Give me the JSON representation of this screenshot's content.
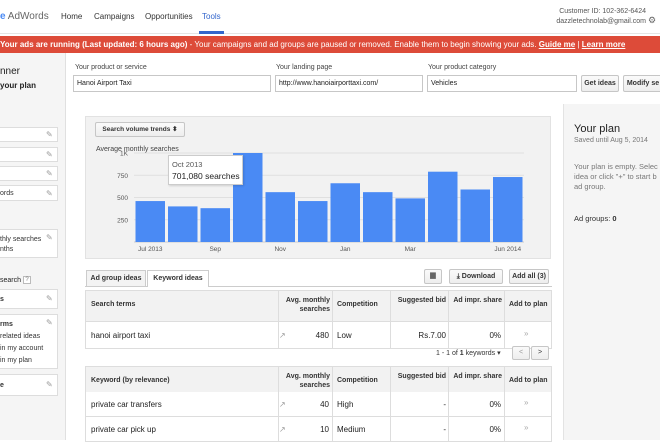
{
  "header": {
    "logo_google": "e",
    "logo_text": "AdWords",
    "nav": [
      "Home",
      "Campaigns",
      "Opportunities",
      "Tools"
    ],
    "customer_id": "Customer ID: 102-362-6424",
    "email": "dazzletechnolab@gmail.com"
  },
  "alert": {
    "bold_text": "Your ads are running (Last updated: 6 hours ago)",
    "text": " - Your campaigns and ad groups are paused or removed. Enable them to begin showing your ads.",
    "link1": "Guide me",
    "sep": " | ",
    "link2": "Learn more"
  },
  "left": {
    "title1": "nner",
    "title2": "your plan",
    "item_words": "ords",
    "monthly1": "thly searches",
    "monthly2": "nths",
    "search": "search",
    "s_label": "s",
    "terms": "rms",
    "related": "related ideas",
    "account": "in my account",
    "plan": "in my plan",
    "e_label": "e"
  },
  "form": {
    "product_label": "Your product or service",
    "product_value": "Hanoi Airport Taxi",
    "landing_label": "Your landing page",
    "landing_value": "http://www.hanoiairporttaxi.com/",
    "category_label": "Your product category",
    "category_value": "Vehicles",
    "get_ideas": "Get ideas",
    "modify": "Modify se"
  },
  "chart_panel": {
    "dropdown": "Search volume trends",
    "dropdown_arrow": "⬍",
    "subtitle": "Average monthly searches",
    "tooltip_month": "Oct 2013",
    "tooltip_value": "701,080 searches"
  },
  "chart_data": {
    "type": "bar",
    "title": "",
    "ylabel": "Average monthly searches",
    "categories": [
      "Jul 2013",
      "Aug 2013",
      "Sep 2013",
      "Oct 2013",
      "Nov 2013",
      "Dec 2013",
      "Jan 2014",
      "Feb 2014",
      "Mar 2014",
      "Apr 2014",
      "May 2014",
      "Jun 2014"
    ],
    "values": [
      460,
      400,
      380,
      1000,
      560,
      460,
      660,
      560,
      490,
      790,
      590,
      730
    ],
    "yticks": [
      "1K",
      "750",
      "500",
      "250"
    ],
    "ytick_values": [
      1000,
      750,
      500,
      250
    ],
    "xtick_labels": [
      "Jul 2013",
      "Sep",
      "Nov",
      "Jan",
      "Mar",
      "Jun 2014"
    ],
    "xtick_indices": [
      0,
      2,
      4,
      6,
      8,
      11
    ],
    "ylim": [
      0,
      1000
    ],
    "bar_color": "#4a8af4",
    "grid": true
  },
  "tabs": {
    "ad_group": "Ad group ideas",
    "keyword": "Keyword ideas"
  },
  "actions": {
    "download": "Download",
    "add_all": "Add all (3)",
    "download_icon": "⤓",
    "chart_icon": "▆"
  },
  "table1": {
    "headers": [
      "Search terms",
      "Avg. monthly searches",
      "Competition",
      "Suggested bid",
      "Ad impr. share",
      "Add to plan"
    ],
    "rows": [
      {
        "term": "hanoi airport taxi",
        "searches": "480",
        "competition": "Low",
        "bid": "Rs.7.00",
        "share": "0%"
      }
    ]
  },
  "pager": {
    "text_pre": "1 - 1 of ",
    "count": "1",
    "text_post": " keywords",
    "arrow": "▾",
    "prev": "<",
    "next": ">"
  },
  "table2": {
    "headers": [
      "Keyword (by relevance)",
      "Avg. monthly searches",
      "Competition",
      "Suggested bid",
      "Ad impr. share",
      "Add to plan"
    ],
    "rows": [
      {
        "term": "private car transfers",
        "searches": "40",
        "competition": "High",
        "bid": "-",
        "share": "0%"
      },
      {
        "term": "private car pick up",
        "searches": "10",
        "competition": "Medium",
        "bid": "-",
        "share": "0%"
      }
    ]
  },
  "plan": {
    "title": "Your plan",
    "saved": "Saved until Aug 5, 2014",
    "empty1": "Your plan is empty. Selec",
    "empty2": "idea or click \"+\" to start b",
    "empty3": "ad group.",
    "ad_groups_label": "Ad groups:",
    "ad_groups_value": "0"
  },
  "icons": {
    "pencil": "✎",
    "add": "»",
    "question": "?",
    "gear": "⚙",
    "trend": "↗"
  }
}
